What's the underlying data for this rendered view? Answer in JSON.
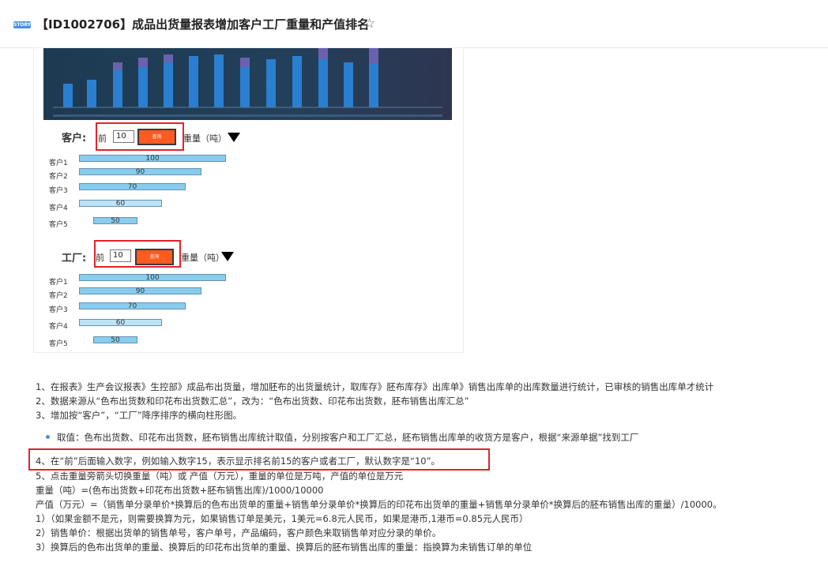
{
  "header": {
    "badge": "STORY",
    "title": "【ID1002706】成品出货量报表增加客户工厂重量和产值排名",
    "star_icon": "star-outline-icon"
  },
  "mock": {
    "customer": {
      "label": "客户:",
      "qian": "前",
      "input_value": "10",
      "query_label": "查询",
      "unit": "重量（吨）",
      "bars": [
        {
          "label": "客户1",
          "value": 100
        },
        {
          "label": "客户2",
          "value": 90
        },
        {
          "label": "客户3",
          "value": 70
        },
        {
          "label": "客户4",
          "value": 60
        },
        {
          "label": "客户5",
          "value": 50
        }
      ]
    },
    "factory": {
      "label": "工厂:",
      "qian": "前",
      "input_value": "10",
      "query_label": "查询",
      "unit": "重量（吨）",
      "bars": [
        {
          "label": "客户1",
          "value": 100
        },
        {
          "label": "客户2",
          "value": 90
        },
        {
          "label": "客户3",
          "value": 70
        },
        {
          "label": "客户4",
          "value": 60
        },
        {
          "label": "客户5",
          "value": 50
        }
      ]
    }
  },
  "content": {
    "l1": "1、在报表》生产会议报表》生控部》成品布出货量，增加胚布的出货量统计，取库存》胚布库存》出库单》销售出库单的出库数量进行统计，已审核的销售出库单才统计",
    "l2": "2、数据来源从“色布出货数和印花布出货数汇总”，改为：“色布出货数、印花布出货数，胚布销售出库汇总”",
    "l3": "3、增加按“客户”，“工厂”降序排序的横向柱形图。",
    "bullet": "取值：色布出货数、印花布出货数，胚布销售出库统计取值，分别按客户和工厂汇总，胚布销售出库单的收货方是客户，根据“来源单据”找到工厂",
    "l4": "4、在“前”后面输入数字，例如输入数字15，表示显示排名前15的客户或者工厂，默认数字是“10”。",
    "l5": "5、点击重量旁箭头切换重量（吨）或 产值（万元），重量的单位是万吨，产值的单位是万元",
    "l6": "重量（吨）=(色布出货数+印花布出货数+胚布销售出库)/1000/10000",
    "l7": "产值（万元）=（销售单分录单价*换算后的色布出货单的重量+销售单分录单价*换算后的印花布出货单的重量+销售单分录单价*换算后的胚布销售出库的重量）/10000。",
    "l8": "1）（如果金额不是元，则需要换算为元，如果销售订单是美元，1美元=6.8元人民币，如果是港币,1港币=0.85元人民币）",
    "l9": "2）销售单价：根据出货单的销售单号，客户单号，产品编码，客户颜色来取销售单对应分录的单价。",
    "l10": "3）换算后的色布出货单的重量、换算后的印花布出货单的重量、换算后的胚布销售出库的重量：指换算为未销售订单的单位"
  },
  "colors": {
    "highlight_box": "#e0242b",
    "query_button": "#ff5a1f",
    "bar_fill": "#88cdee",
    "bullet": "#4a90e2"
  }
}
